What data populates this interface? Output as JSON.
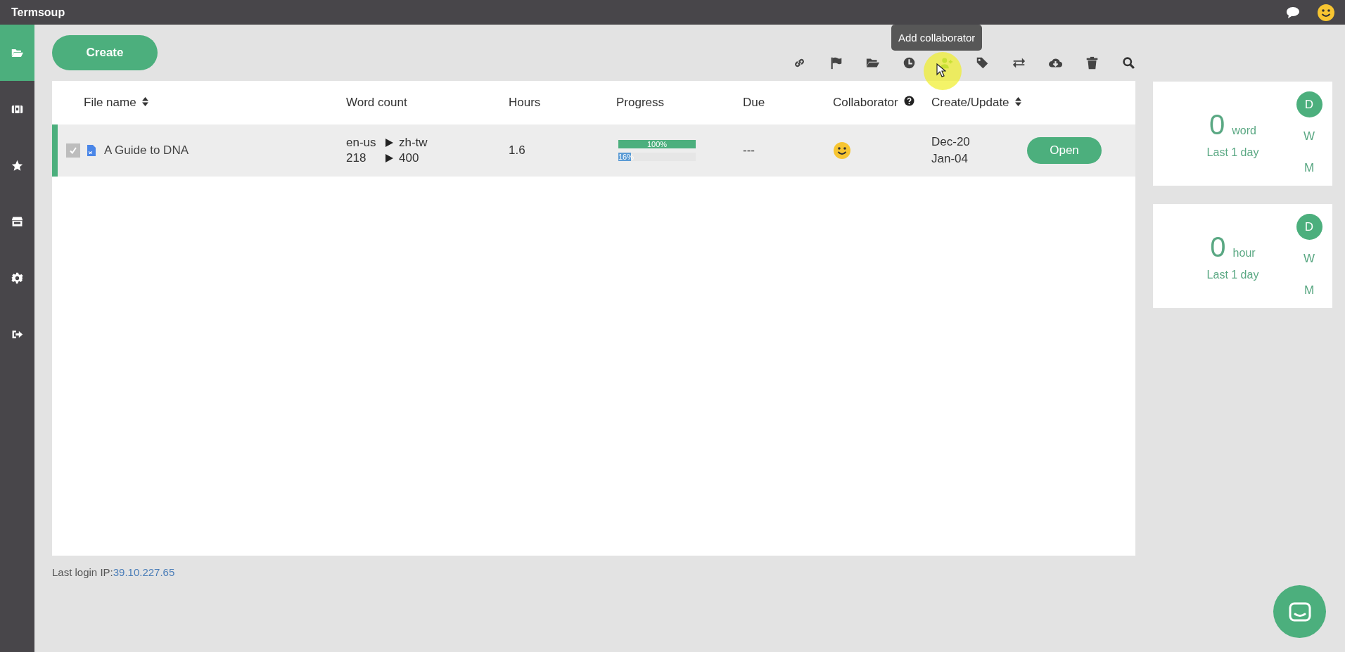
{
  "app": {
    "title": "Termsoup"
  },
  "sidebar": {
    "items": [
      {
        "kind": "folder",
        "selected": true
      },
      {
        "kind": "chest",
        "selected": false
      },
      {
        "kind": "star",
        "selected": false
      },
      {
        "kind": "store",
        "selected": false
      },
      {
        "kind": "gear",
        "selected": false
      },
      {
        "kind": "logout",
        "selected": false
      }
    ]
  },
  "toolbar": {
    "create_button": "Create",
    "tooltip": "Add collaborator",
    "icons": [
      {
        "kind": "link"
      },
      {
        "kind": "flag"
      },
      {
        "kind": "folder"
      },
      {
        "kind": "clock"
      },
      {
        "kind": "add-user"
      },
      {
        "kind": "tag"
      },
      {
        "kind": "swap"
      },
      {
        "kind": "download"
      },
      {
        "kind": "trash"
      },
      {
        "kind": "search"
      }
    ]
  },
  "table": {
    "columns": [
      {
        "label": "File name",
        "sortable": true
      },
      {
        "label": "Word count",
        "sortable": false
      },
      {
        "label": "Hours",
        "sortable": false
      },
      {
        "label": "Progress",
        "sortable": false
      },
      {
        "label": "Due",
        "sortable": false
      },
      {
        "label": "Collaborator",
        "sortable": false,
        "help": true
      },
      {
        "label": "Create/Update",
        "sortable": true
      }
    ],
    "rows": [
      {
        "selected": true,
        "checked": true,
        "file_name": "A Guide to DNA",
        "source_lang": "en-us",
        "target_lang": "zh-tw",
        "source_words": "218",
        "target_words": "400",
        "hours": "1.6",
        "progress": [
          {
            "label": "100%",
            "level": 1,
            "color": "#4caf7d"
          },
          {
            "label": "16%",
            "level": 0.16,
            "color": "#5b9bd5"
          }
        ],
        "due": "---",
        "created": "Dec-20",
        "updated": "Jan-04",
        "action": "Open"
      }
    ]
  },
  "stats": [
    {
      "value": "0",
      "unit": "word",
      "period": "Last 1 day",
      "ranges": [
        {
          "label": "D",
          "selected": true
        },
        {
          "label": "W",
          "selected": false
        },
        {
          "label": "M",
          "selected": false
        }
      ]
    },
    {
      "value": "0",
      "unit": "hour",
      "period": "Last 1 day",
      "ranges": [
        {
          "label": "D",
          "selected": true
        },
        {
          "label": "W",
          "selected": false
        },
        {
          "label": "M",
          "selected": false
        }
      ]
    }
  ],
  "footer": {
    "label": "Last login IP:",
    "ip": "39.10.227.65"
  }
}
